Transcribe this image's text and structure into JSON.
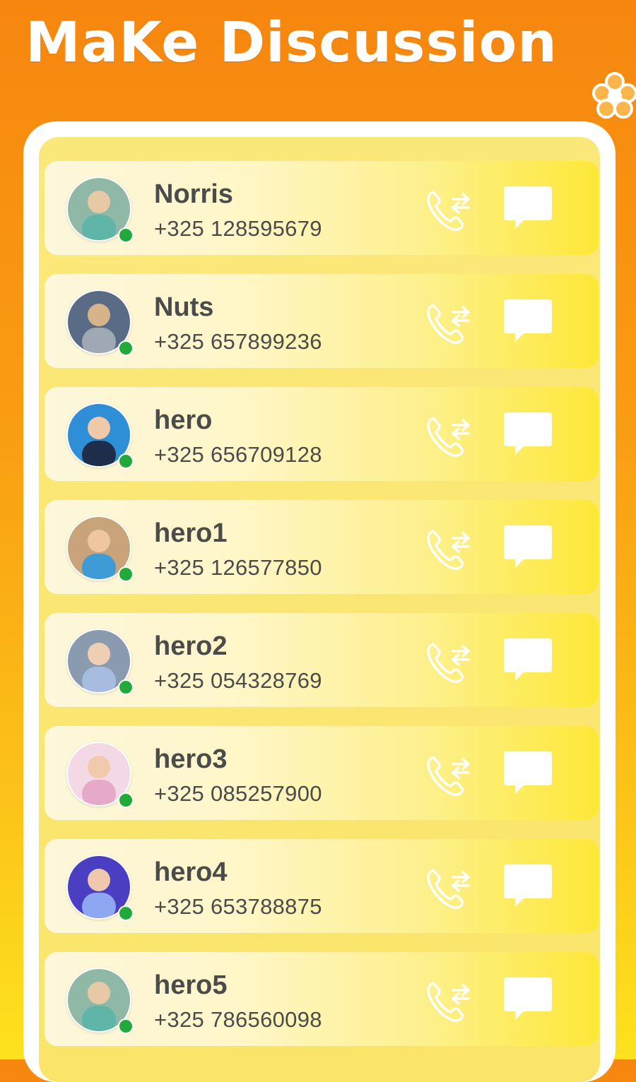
{
  "header": {
    "title": "MaKe Discussion"
  },
  "contacts": [
    {
      "name": "Norris",
      "phone": "+325 128595679",
      "avatar_colors": [
        "#8fb9a6",
        "#e7c9a5",
        "#5fb5a8"
      ]
    },
    {
      "name": "Nuts",
      "phone": "+325 657899236",
      "avatar_colors": [
        "#5a6c85",
        "#d7b38a",
        "#9fa9b5"
      ]
    },
    {
      "name": "hero",
      "phone": "+325 656709128",
      "avatar_colors": [
        "#2f8fd6",
        "#f0c9a8",
        "#1e2d4a"
      ]
    },
    {
      "name": "hero1",
      "phone": "+325 126577850",
      "avatar_colors": [
        "#c9a47a",
        "#f0c6a0",
        "#3e9bd6"
      ]
    },
    {
      "name": "hero2",
      "phone": "+325 054328769",
      "avatar_colors": [
        "#8a9bb0",
        "#efcfb3",
        "#a7bde0"
      ]
    },
    {
      "name": "hero3",
      "phone": "+325 085257900",
      "avatar_colors": [
        "#f3d9e6",
        "#f1c9ad",
        "#e6a9c8"
      ]
    },
    {
      "name": "hero4",
      "phone": "+325 653788875",
      "avatar_colors": [
        "#4a3fc2",
        "#f0c8ad",
        "#8fa6f0"
      ]
    },
    {
      "name": "hero5",
      "phone": "+325 786560098",
      "avatar_colors": [
        "#8fb9a6",
        "#e7c9a5",
        "#5fb5a8"
      ]
    }
  ],
  "icons": {
    "call": "call-forward-icon",
    "message": "message-bubble-icon",
    "status": "online-dot-icon",
    "decor": "flower-icon"
  },
  "colors": {
    "online": "#1faa3a",
    "text": "#4b4b4b",
    "accent_top": "#f7860f",
    "accent_bottom": "#fde21e"
  }
}
